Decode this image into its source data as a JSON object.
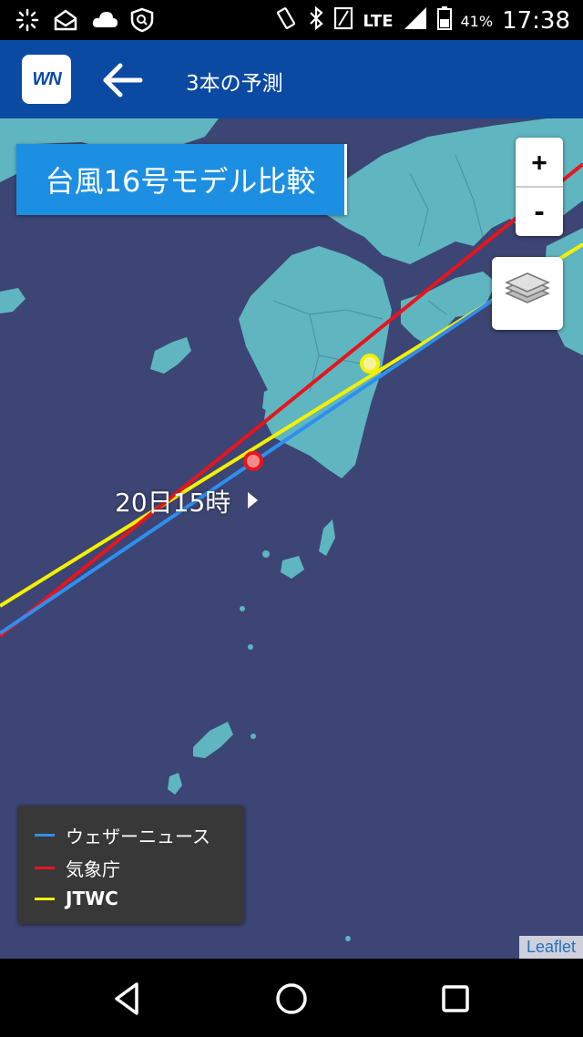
{
  "status_bar": {
    "network": "LTE",
    "battery": "41%",
    "time": "17:38",
    "icons": [
      "loading-icon",
      "mail-icon",
      "cloud-icon",
      "shield-icon",
      "vibrate-icon",
      "bluetooth-icon",
      "sim-icon",
      "signal-icon",
      "battery-icon"
    ]
  },
  "app_bar": {
    "logo_text": "WN",
    "back_icon": "arrow-left-icon",
    "title": "3本の予測"
  },
  "map": {
    "title": "台風16号モデル比較",
    "zoom_in": "+",
    "zoom_out": "-",
    "layers_icon": "layers-icon",
    "time_label": "20日15時",
    "colors": {
      "sea": "#3c4573",
      "land": "#5fb6c0",
      "weathernews": "#2f8ff0",
      "jma": "#e8141c",
      "jtwc": "#f5f000"
    },
    "legend": [
      {
        "label": "ウェザーニュース",
        "color": "#2f8ff0"
      },
      {
        "label": "気象庁",
        "color": "#e8141c"
      },
      {
        "label": "JTWC",
        "color": "#f5f000"
      }
    ],
    "attribution": "Leaflet"
  },
  "nav_bar": {
    "buttons": [
      "back-triangle-icon",
      "home-circle-icon",
      "recents-square-icon"
    ]
  }
}
